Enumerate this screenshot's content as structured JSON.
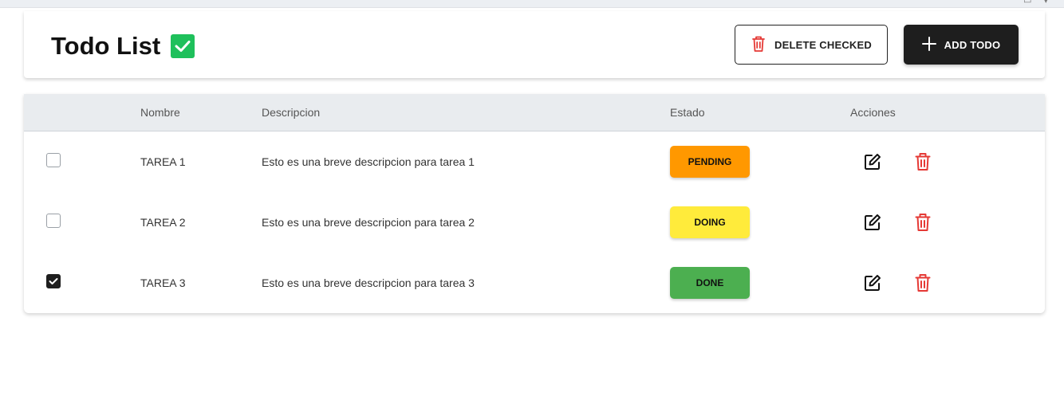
{
  "app": {
    "title": "Todo List"
  },
  "toolbar": {
    "delete_checked_label": "DELETE CHECKED",
    "add_todo_label": "ADD TODO"
  },
  "table": {
    "columns": [
      "Nombre",
      "Descripcion",
      "Estado",
      "Acciones"
    ],
    "rows": [
      {
        "checked": false,
        "nombre": "TAREA 1",
        "descripcion": "Esto es una breve descripcion para tarea 1",
        "estado": "PENDING",
        "estado_color": "#ff9800"
      },
      {
        "checked": false,
        "nombre": "TAREA 2",
        "descripcion": "Esto es una breve descripcion para tarea 2",
        "estado": "DOING",
        "estado_color": "#ffeb3b"
      },
      {
        "checked": true,
        "nombre": "TAREA 3",
        "descripcion": "Esto es una breve descripcion para tarea 3",
        "estado": "DONE",
        "estado_color": "#4caf50"
      }
    ]
  },
  "colors": {
    "accent_green": "#1ec05b",
    "danger_red": "#e53935",
    "dark": "#1e1e1e"
  },
  "icons": {
    "title": "check-square-icon",
    "delete_checked": "trash-icon",
    "add": "plus-icon",
    "edit": "edit-icon",
    "delete": "trash-icon"
  }
}
